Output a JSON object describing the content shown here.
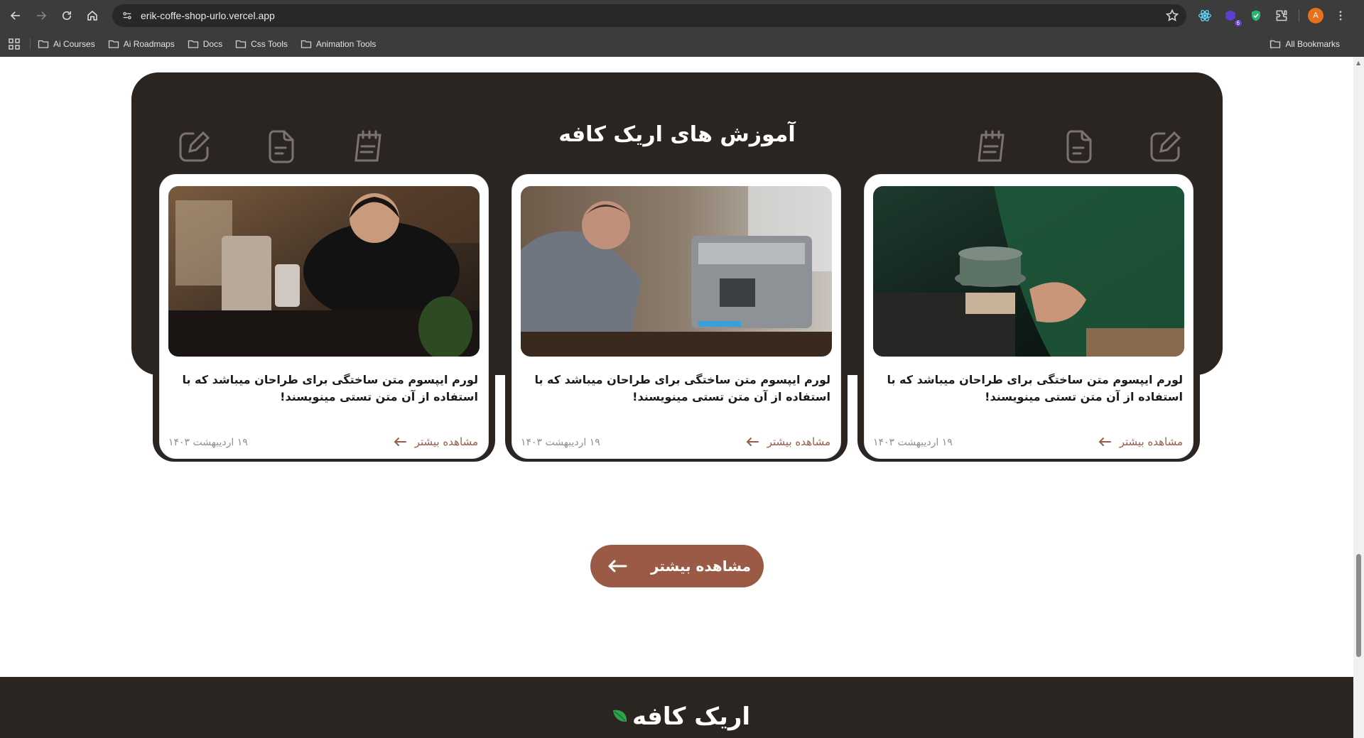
{
  "browser": {
    "url": "erik-coffe-shop-urlo.vercel.app",
    "extension_badge": "6",
    "profile_initial": "A",
    "bookmarks": [
      "Ai Courses",
      "Ai Roadmaps",
      "Docs",
      "Css Tools",
      "Animation Tools"
    ],
    "all_bookmarks": "All Bookmarks"
  },
  "blog": {
    "title": "آموزش های اریک کافه",
    "cards": [
      {
        "title": "لورم ایپسوم متن ساختگی برای طراحان میباشد که با استفاده از آن متن تستی مینویسند!",
        "more": "مشاهده بیشتر",
        "date": "۱۹ اردیبهشت ۱۴۰۳",
        "image": "barista-pouring-shaker"
      },
      {
        "title": "لورم ایپسوم متن ساختگی برای طراحان میباشد که با استفاده از آن متن تستی مینویسند!",
        "more": "مشاهده بیشتر",
        "date": "۱۹ اردیبهشت ۱۴۰۳",
        "image": "barista-espresso-machine"
      },
      {
        "title": "لورم ایپسوم متن ساختگی برای طراحان میباشد که با استفاده از آن متن تستی مینویسند!",
        "more": "مشاهده بیشتر",
        "date": "۱۹ اردیبهشت ۱۴۰۳",
        "image": "barista-holding-cup"
      }
    ]
  },
  "view_more_button": "مشاهده بیشتر",
  "footer": {
    "logo": "اریک کافه"
  },
  "colors": {
    "panel": "#2b2522",
    "accent": "#9a5a45",
    "leaf": "#2fa34a"
  },
  "icons": [
    "back-icon",
    "forward-icon",
    "reload-icon",
    "home-icon",
    "site-settings-icon",
    "star-icon",
    "extensions-icon",
    "menu-dots-icon",
    "folder-icon",
    "edit-icon",
    "note-icon",
    "notepad-icon",
    "arrow-left-icon",
    "leaf-icon"
  ]
}
